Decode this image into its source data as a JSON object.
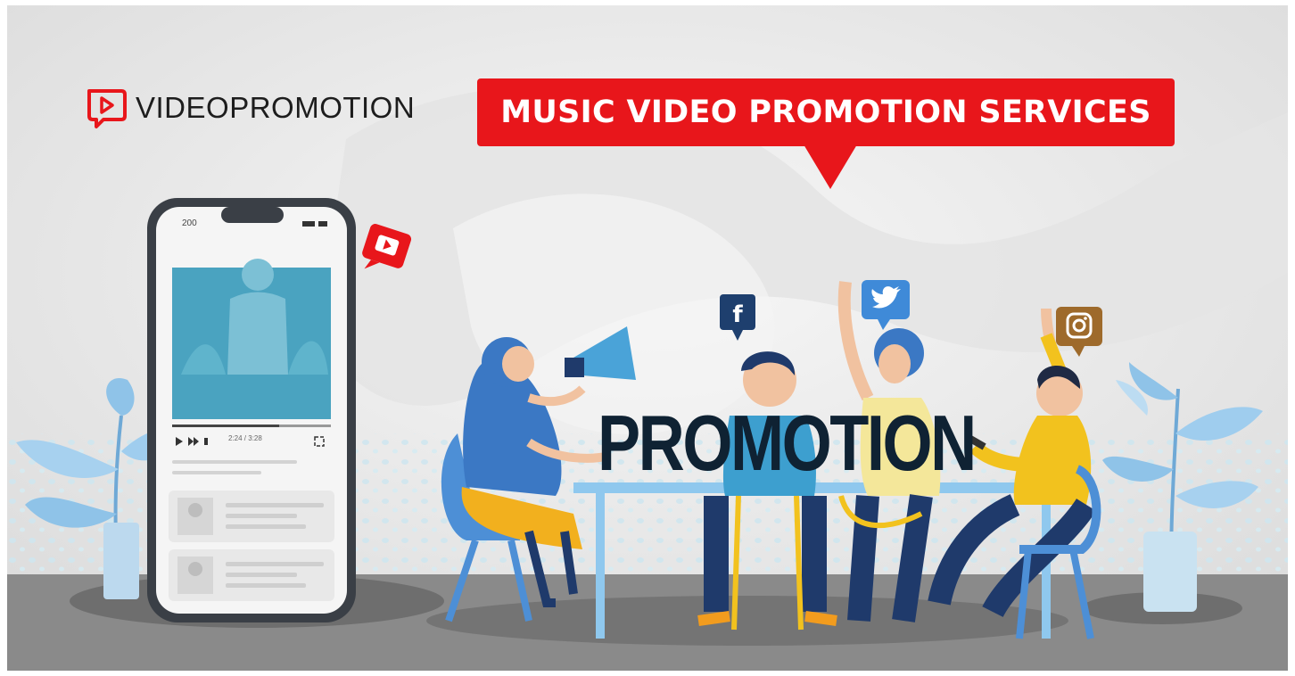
{
  "brand": {
    "name": "VIDEOPROMOTION",
    "logo_color": "#e8161b"
  },
  "banner": {
    "title": "MUSIC VIDEO PROMOTION SERVICES",
    "color": "#e8161b"
  },
  "headline": "PROMOTION",
  "phone": {
    "status_time": "200",
    "player_timecode": "2:24 / 3:28"
  },
  "social_icons": [
    "facebook-icon",
    "twitter-icon",
    "instagram-icon",
    "youtube-play-icon"
  ],
  "colors": {
    "background": "#ececec",
    "accent_red": "#e8161b",
    "navy": "#0f2233",
    "facebook": "#1e3f6e",
    "twitter": "#3f8ad8",
    "instagram": "#9e6a2b",
    "plant": "#8fc3e8"
  }
}
